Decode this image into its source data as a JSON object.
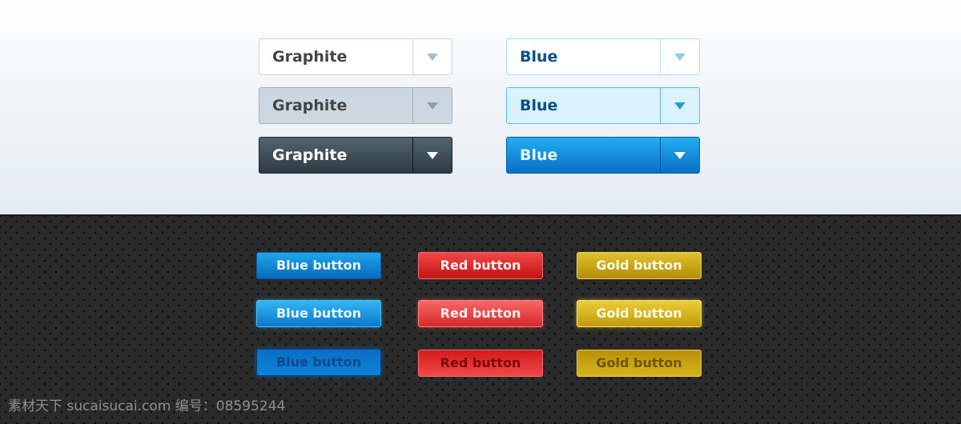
{
  "selects": {
    "graphite": [
      {
        "label": "Graphite",
        "state": "normal"
      },
      {
        "label": "Graphite",
        "state": "hover"
      },
      {
        "label": "Graphite",
        "state": "active"
      }
    ],
    "blue": [
      {
        "label": "Blue",
        "state": "normal"
      },
      {
        "label": "Blue",
        "state": "hover"
      },
      {
        "label": "Blue",
        "state": "active"
      }
    ]
  },
  "buttons": {
    "blue": [
      {
        "label": "Blue button",
        "state": "normal"
      },
      {
        "label": "Blue button",
        "state": "hover"
      },
      {
        "label": "Blue button",
        "state": "pressed"
      }
    ],
    "red": [
      {
        "label": "Red button",
        "state": "normal"
      },
      {
        "label": "Red button",
        "state": "hover"
      },
      {
        "label": "Red button",
        "state": "pressed"
      }
    ],
    "gold": [
      {
        "label": "Gold button",
        "state": "normal"
      },
      {
        "label": "Gold button",
        "state": "hover"
      },
      {
        "label": "Gold button",
        "state": "pressed"
      }
    ]
  },
  "colors": {
    "blue_accent": "#0a7bd0",
    "red_accent": "#d82828",
    "gold_accent": "#c8a010",
    "graphite": "#3a4a54"
  },
  "watermark": "素材天下 sucaisucai.com  编号：08595244"
}
